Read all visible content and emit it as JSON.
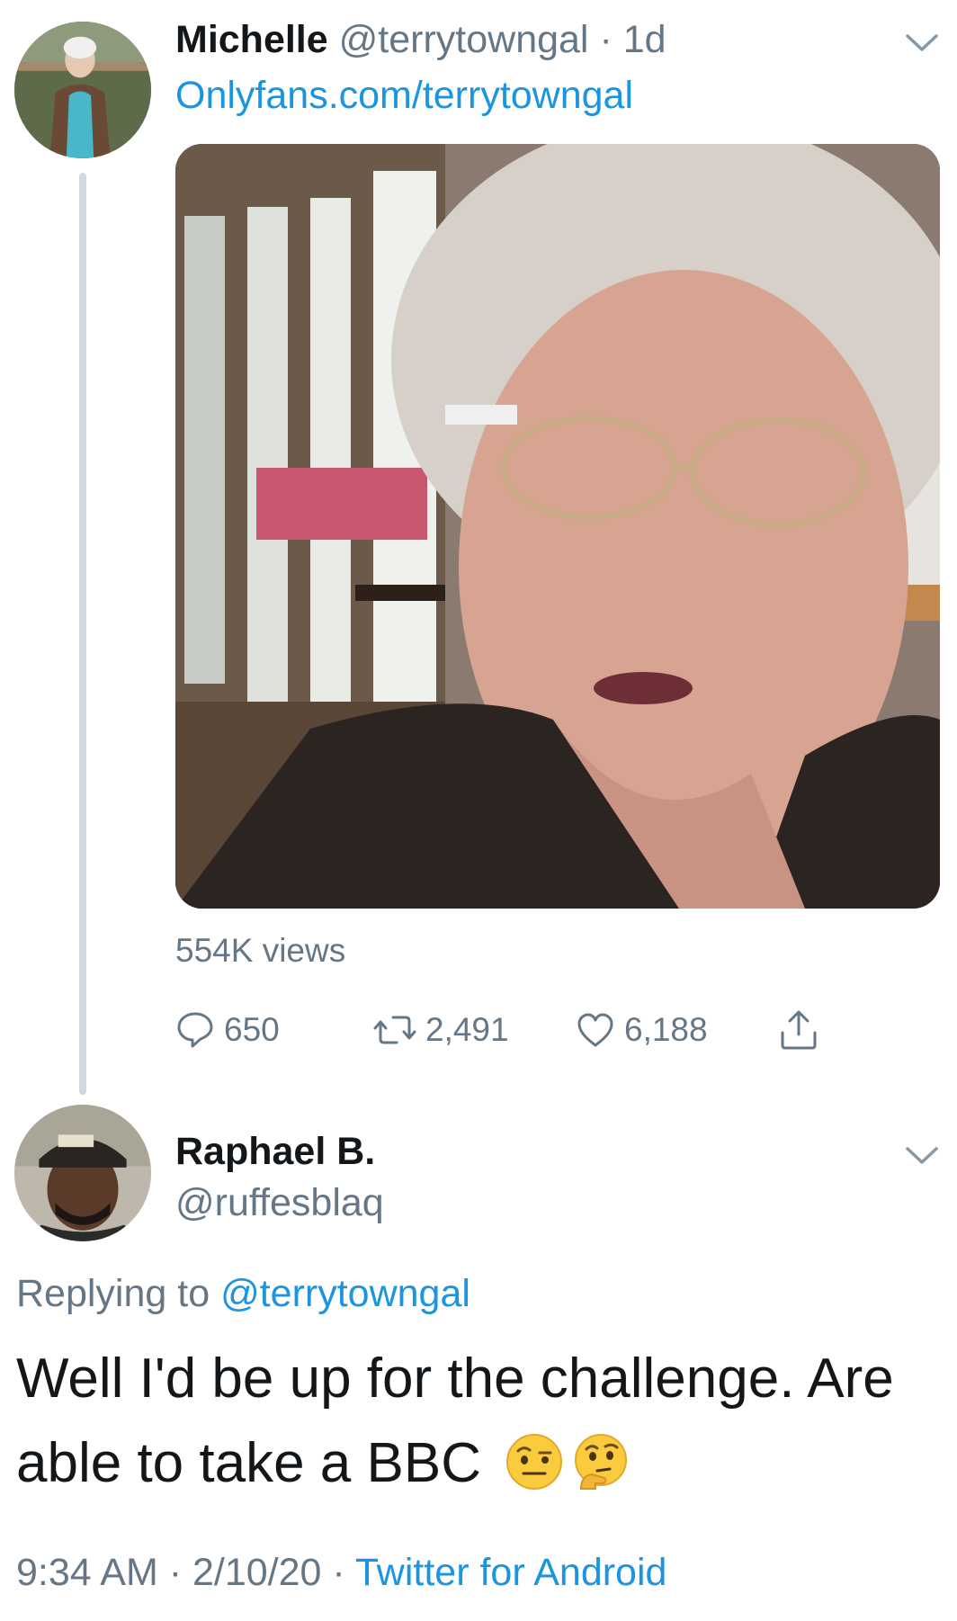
{
  "tweet": {
    "author_name": "Michelle",
    "author_handle": "@terrytowngal",
    "separator": " · ",
    "age": "1d",
    "bio_link": "Onlyfans.com/terrytowngal",
    "views": "554K views",
    "reply_count": "650",
    "retweet_count": "2,491",
    "like_count": "6,188"
  },
  "reply": {
    "author_name": "Raphael B.",
    "author_handle": "@ruffesblaq",
    "replying_prefix": "Replying to ",
    "replying_to": "@terrytowngal",
    "text": "Well I'd be up for the challenge. Are able to take a BBC",
    "time": "9:34 AM",
    "sep1": " · ",
    "date": "2/10/20",
    "sep2": " · ",
    "source": "Twitter for Android"
  },
  "colors": {
    "link": "#1b95e0",
    "muted": "#657786",
    "text": "#14171a",
    "thread_line": "#cfd9de"
  },
  "icons": [
    "chevron-down-icon",
    "reply-icon",
    "retweet-icon",
    "like-icon",
    "share-icon",
    "raised-eyebrow-emoji",
    "thinking-face-emoji"
  ]
}
